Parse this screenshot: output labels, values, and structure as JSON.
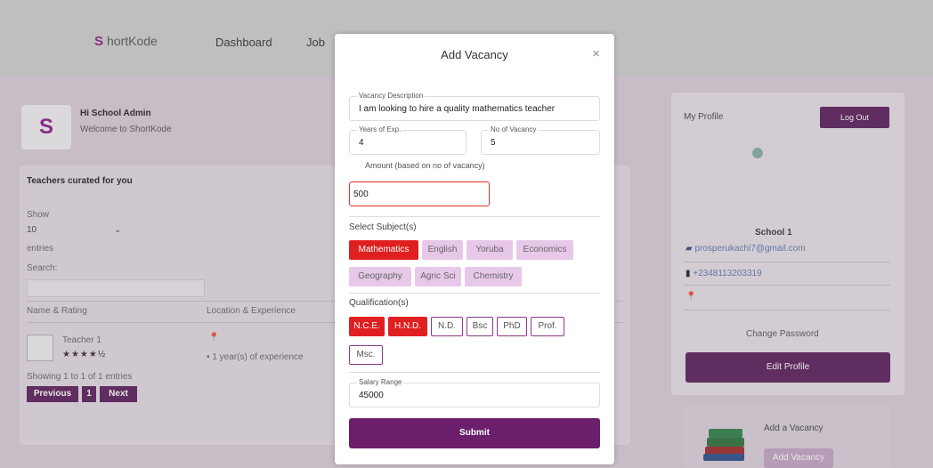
{
  "navbar": {
    "brand_letter": "S",
    "brand_rest": "hortKode",
    "links": [
      "Dashboard",
      "Job"
    ]
  },
  "admin": {
    "avatar_letter": "S",
    "name": "Hi School Admin",
    "subtitle": "Welcome to ShortKode"
  },
  "teachers": {
    "title": "Teachers curated for you",
    "show_label": "Show",
    "show_value": "10",
    "entries_label": "entries",
    "search_label": "Search:",
    "col_name": "Name & Rating",
    "col_location": "Location & Experience",
    "row_name": "Teacher 1",
    "row_rating": 4.5,
    "row_experience": "1 year(s) of experience",
    "showing": "Showing 1 to 1 of 1 entries",
    "prev": "Previous",
    "page": "1",
    "next": "Next"
  },
  "profile": {
    "title": "My Profile",
    "logout": "Log Out",
    "school": "School 1",
    "email": "prosperukachi7@gmail.com",
    "phone": "+2348113203319",
    "change_password": "Change Password",
    "edit_profile": "Edit Profile",
    "add_vacancy_title": "Add a Vacancy",
    "add_vacancy_btn": "Add Vacancy"
  },
  "modal": {
    "title": "Add Vacancy",
    "close": "×",
    "description_label": "Vacancy Description",
    "description_value": "I am looking to hire a quality mathematics teacher",
    "years_label": "Years of Exp.",
    "years_value": "4",
    "vacancy_no_label": "No of Vacancy",
    "vacancy_no_value": "5",
    "amount_label": "Amount (based on no of vacancy)",
    "amount_value": "500",
    "subjects_label": "Select Subject(s)",
    "subjects": [
      {
        "label": "Mathematics",
        "selected": true
      },
      {
        "label": "English",
        "selected": false
      },
      {
        "label": "Yoruba",
        "selected": false
      },
      {
        "label": "Economics",
        "selected": false
      },
      {
        "label": "Geography",
        "selected": false
      },
      {
        "label": "Agric Sci",
        "selected": false
      },
      {
        "label": "Chemistry",
        "selected": false
      }
    ],
    "qualifications_label": "Qualification(s)",
    "qualifications": [
      {
        "label": "N.C.E.",
        "selected": true
      },
      {
        "label": "H.N.D.",
        "selected": true
      },
      {
        "label": "N.D.",
        "selected": false
      },
      {
        "label": "Bsc",
        "selected": false
      },
      {
        "label": "PhD",
        "selected": false
      },
      {
        "label": "Prof.",
        "selected": false
      },
      {
        "label": "Msc.",
        "selected": false
      }
    ],
    "salary_label": "Salary Range",
    "salary_value": "45000",
    "submit": "Submit"
  },
  "colors": {
    "primary": "#6b1f6b",
    "selected": "#e02020",
    "chip": "#e8c8e8"
  }
}
